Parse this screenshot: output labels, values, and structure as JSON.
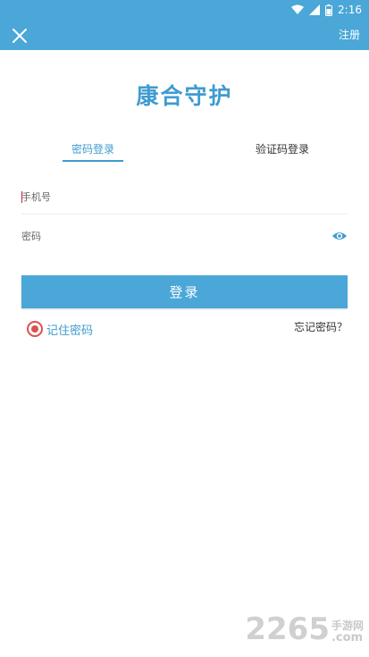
{
  "status_bar": {
    "time": "2:16",
    "icons": [
      "wifi-icon",
      "signal-icon",
      "battery-icon"
    ]
  },
  "app_bar": {
    "close_icon": "close-icon",
    "register_label": "注册"
  },
  "title": "康合守护",
  "tabs": [
    {
      "label": "密码登录",
      "active": true
    },
    {
      "label": "验证码登录",
      "active": false
    }
  ],
  "form": {
    "phone_placeholder": "手机号",
    "password_placeholder": "密码",
    "eye_icon": "eye-icon",
    "login_label": "登录",
    "remember_label": "记住密码",
    "forgot_label": "忘记密码？"
  },
  "watermark": {
    "number": "2265",
    "site_cn": "手游网",
    "site_com": ".com"
  },
  "colors": {
    "primary": "#4aa7d7",
    "title": "#3f9bd0",
    "radio": "#d9534f"
  }
}
